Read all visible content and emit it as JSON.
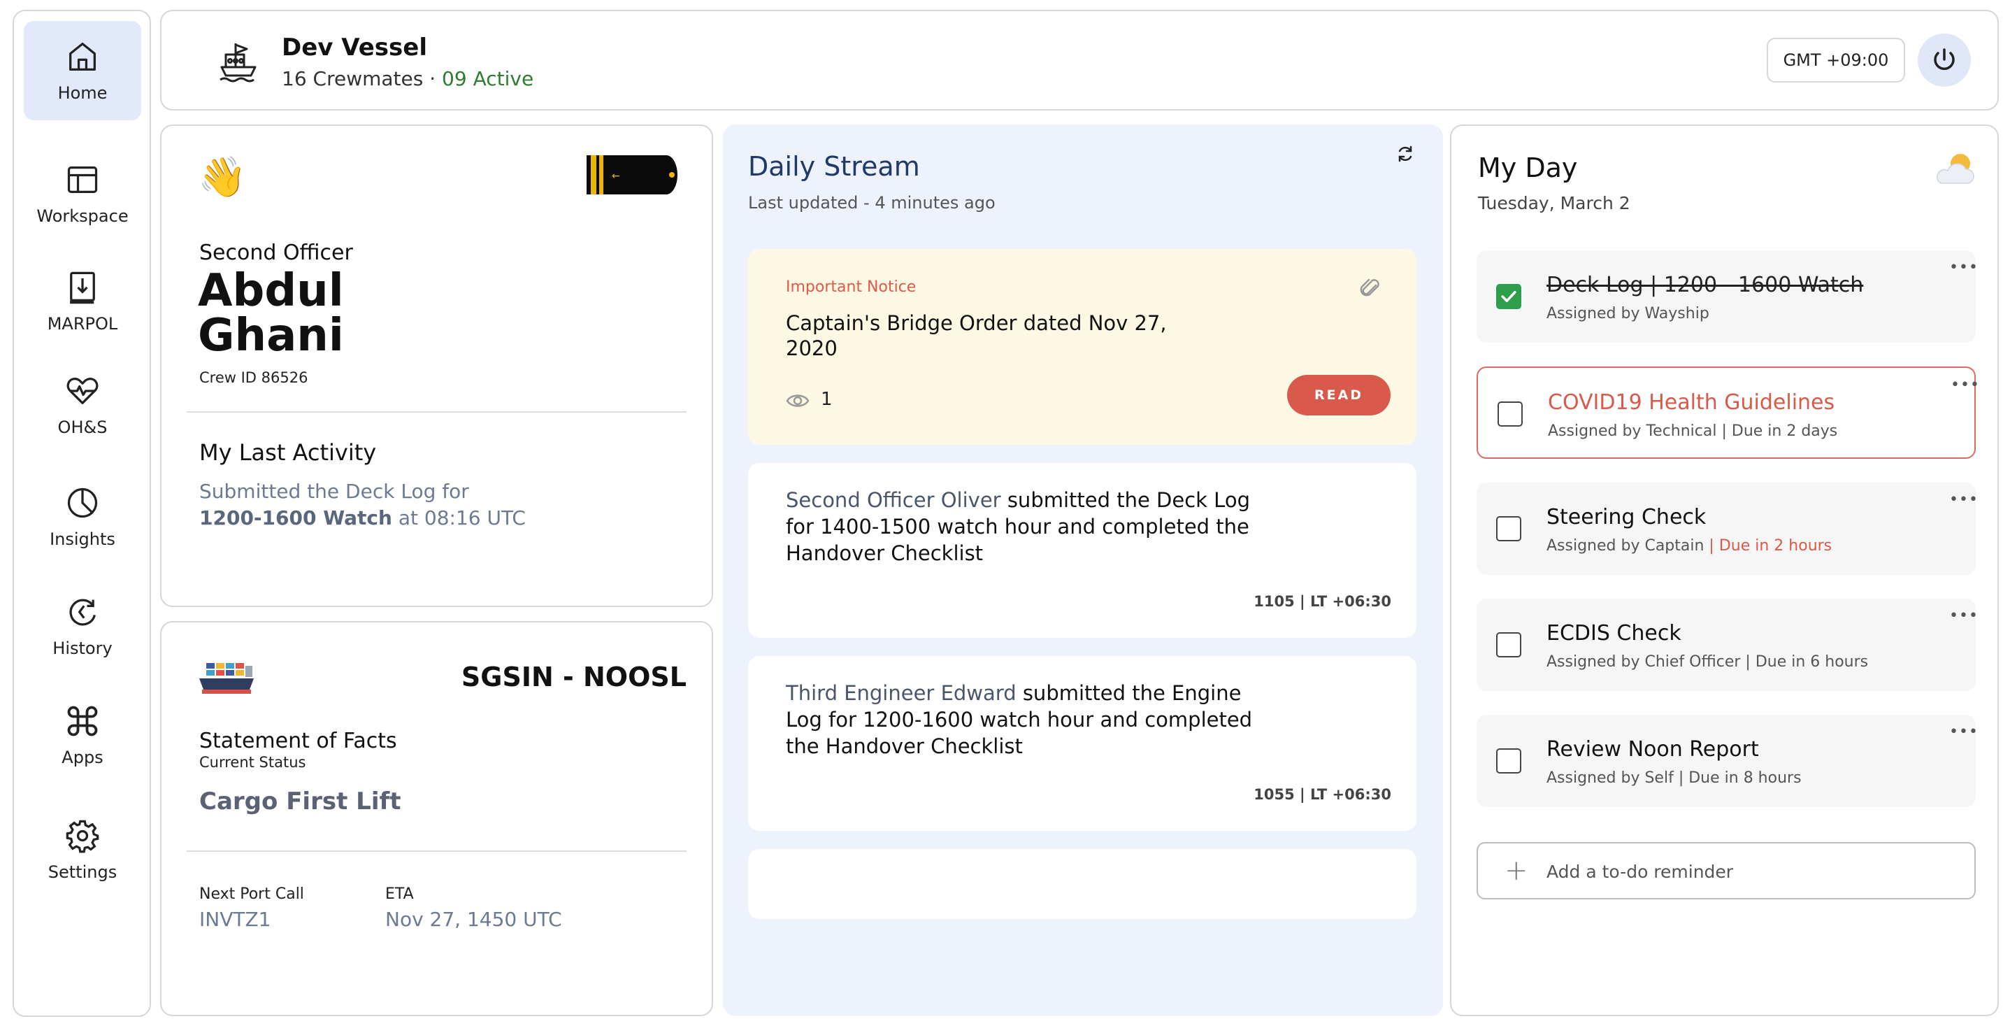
{
  "sidebar": {
    "items": [
      {
        "label": "Home",
        "icon": "home-icon",
        "active": true
      },
      {
        "label": "Workspace",
        "icon": "workspace-icon"
      },
      {
        "label": "MARPOL",
        "icon": "marpol-book-icon"
      },
      {
        "label": "OH&S",
        "icon": "heart-pulse-icon"
      },
      {
        "label": "Insights",
        "icon": "pie-chart-icon"
      },
      {
        "label": "History",
        "icon": "history-icon"
      },
      {
        "label": "Apps",
        "icon": "command-icon"
      },
      {
        "label": "Settings",
        "icon": "gear-icon"
      }
    ]
  },
  "header": {
    "vessel_name": "Dev Vessel",
    "crewmates": "16 Crewmates",
    "separator": " · ",
    "active": "09 Active",
    "timezone": "GMT +09:00",
    "icon": "ship-icon"
  },
  "profile": {
    "wave_emoji": "👋",
    "rank": "Second Officer",
    "first_name": "Abdul",
    "last_name": "Ghani",
    "crew_id": "Crew ID 86526",
    "activity_title": "My Last Activity",
    "activity_prefix": "Submitted the Deck Log for",
    "activity_bold": "1200-1600 Watch",
    "activity_suffix": " at 08:16 UTC"
  },
  "voyage": {
    "route": "SGSIN - NOOSL",
    "sof_title": "Statement of Facts",
    "sof_subtitle": "Current Status",
    "status": "Cargo First Lift",
    "next_port_label": "Next Port Call",
    "next_port_value": "INVTZ1",
    "eta_label": "ETA",
    "eta_value": "Nov 27, 1450 UTC"
  },
  "stream": {
    "title": "Daily Stream",
    "updated": "Last updated - 4 minutes ago",
    "notice": {
      "label": "Important Notice",
      "text": "Captain's Bridge Order dated Nov 27, 2020",
      "views": "1",
      "button": "READ"
    },
    "activities": [
      {
        "actor": "Second Officer Oliver",
        "text": " submitted the Deck Log for 1400-1500 watch hour and completed the Handover Checklist",
        "time": "1105 | LT +06:30"
      },
      {
        "actor": "Third Engineer Edward",
        "text": " submitted the Engine Log for 1200-1600 watch hour and completed the Handover Checklist",
        "time": "1055 | LT +06:30"
      }
    ]
  },
  "myday": {
    "title": "My Day",
    "date": "Tuesday, March 2",
    "weather_icon": "partly-cloudy-icon",
    "tasks": [
      {
        "title": "Deck Log | 1200 - 1600 Watch",
        "assigned": "Assigned by Wayship",
        "due": "",
        "done": true
      },
      {
        "title": "COVID19 Health Guidelines",
        "assigned": "Assigned by Technical",
        "due": " | Due in 2 days",
        "alert": true
      },
      {
        "title": "Steering Check",
        "assigned": "Assigned by Captain",
        "due": " | Due in 2 hours",
        "due_red": true
      },
      {
        "title": "ECDIS Check",
        "assigned": "Assigned by Chief Officer",
        "due": " | Due in 6 hours"
      },
      {
        "title": "Review Noon Report",
        "assigned": "Assigned by Self",
        "due": " | Due in 8 hours"
      }
    ],
    "add_placeholder": "Add a to-do reminder"
  },
  "colors": {
    "accent_blue": "#e1e9fb",
    "alert_red": "#d9594a",
    "active_green": "#2e7d32",
    "notice_bg": "#fdf8e3"
  }
}
